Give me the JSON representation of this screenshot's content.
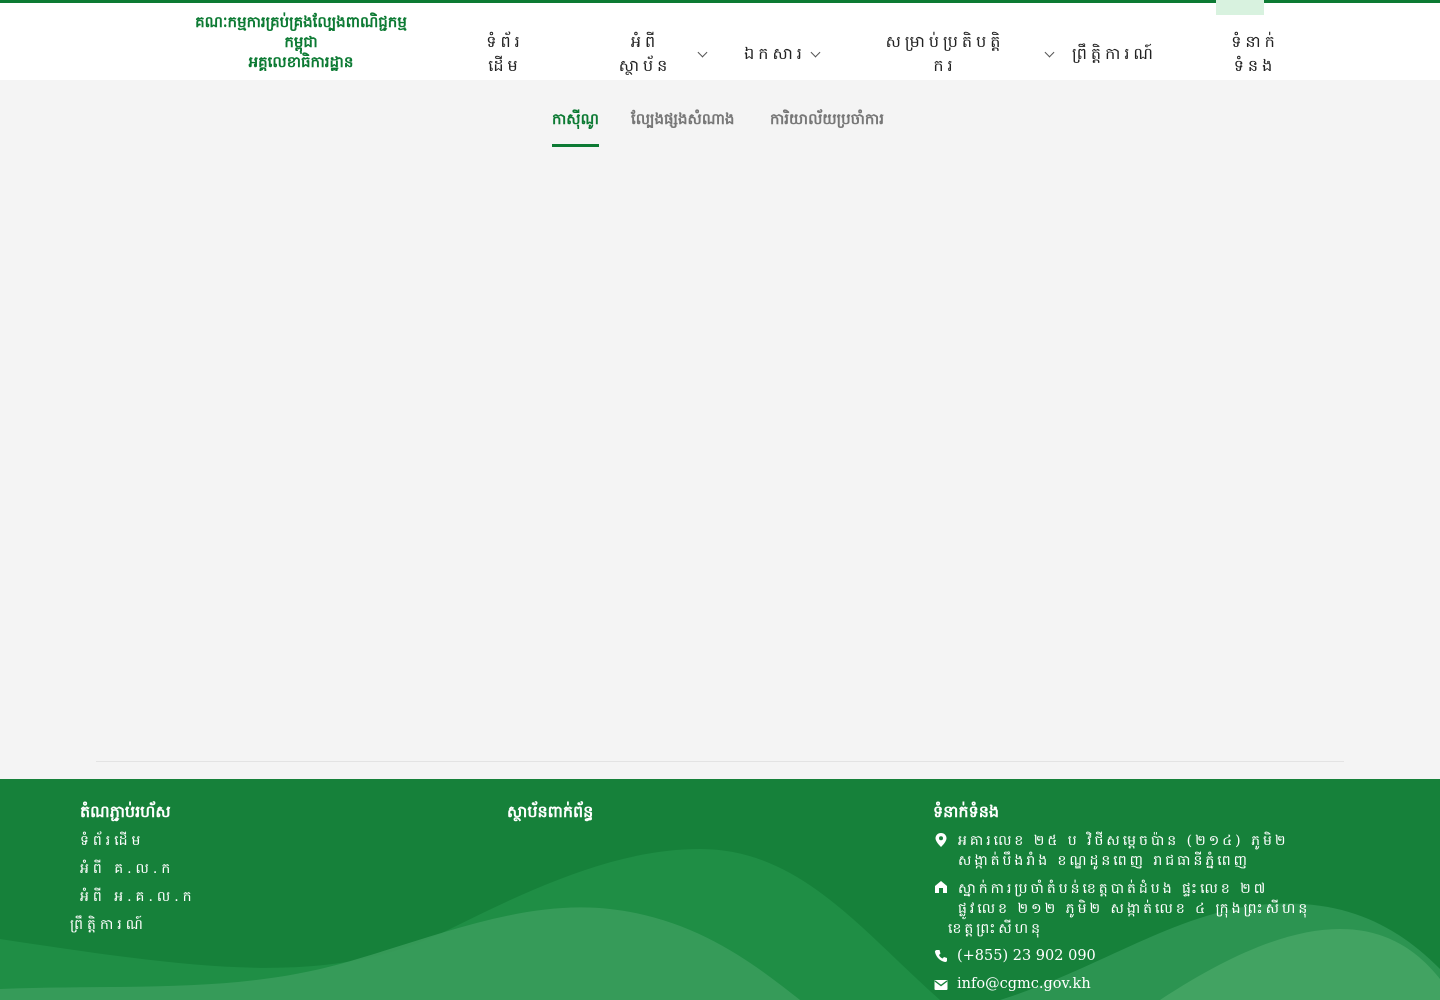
{
  "header": {
    "logo_line1": "គណៈកម្មការគ្រប់គ្រងល្បែងពាណិជ្ជកម្ម",
    "logo_line2": "កម្ពុជា",
    "logo_line3": "អគ្គលេខាធិការដ្ឋាន"
  },
  "nav": {
    "home_l1": "ទំព័រ",
    "home_l2": "ដើម",
    "about_l1": "អំពី",
    "about_l2": "ស្ថាប័ន",
    "documents": "ឯកសារ",
    "operators_l1": "សម្រាប់ប្រតិបត្តិ",
    "operators_l2": "ករ",
    "news": "ព្រឹត្តិការណ៍",
    "contact_l1": "ទំនាក់",
    "contact_l2": "ទំនង"
  },
  "tabs": [
    {
      "label": "កាស៊ីណូ",
      "active": true
    },
    {
      "label": "ល្បែងផ្សងសំណាង",
      "active": false
    },
    {
      "label": "ការិយាល័យប្រចាំការ",
      "active": false
    }
  ],
  "footer": {
    "quick_links_title": "តំណភ្ជាប់រហ័ស",
    "quick_links": [
      "ទំព័រដើម",
      "អំពី គ.ល.ក",
      "អំពី អ.គ.ល.ក",
      "ព្រឹត្តិការណ៍"
    ],
    "related_title": "ស្ថាប័នពាក់ព័ន្ធ",
    "contact_title": "ទំនាក់ទំនង",
    "address1_l1": "អគារលេខ ២៥ ប វិថីសម្តេចប៉ាន (២១៤) ភូមិ២",
    "address1_l2": "សង្កាត់បឹងរាំង ខណ្ឌដូនពេញ រាជធានីភ្នំពេញ",
    "address2_l1": "ស្នាក់ការប្រចាំតំបន់ខេត្តបាត់ដំបង ផ្ទះលេខ ២៧",
    "address2_l2": "ផ្លូវលេខ ២១២ ភូមិ២ សង្កាត់លេខ ៤ ក្រុងព្រះសីហនុ",
    "address2_l3": "ខេត្តព្រះសីហនុ",
    "phone": "(+855) 23 902 090",
    "email": "info@cgmc.gov.kh"
  },
  "colors": {
    "brand_green": "#0c7a33",
    "footer_green": "#16813a",
    "background": "#f4f4f4"
  },
  "icons": {
    "location": "map-pin-icon",
    "office": "building-icon",
    "phone": "phone-icon",
    "email": "envelope-icon"
  }
}
